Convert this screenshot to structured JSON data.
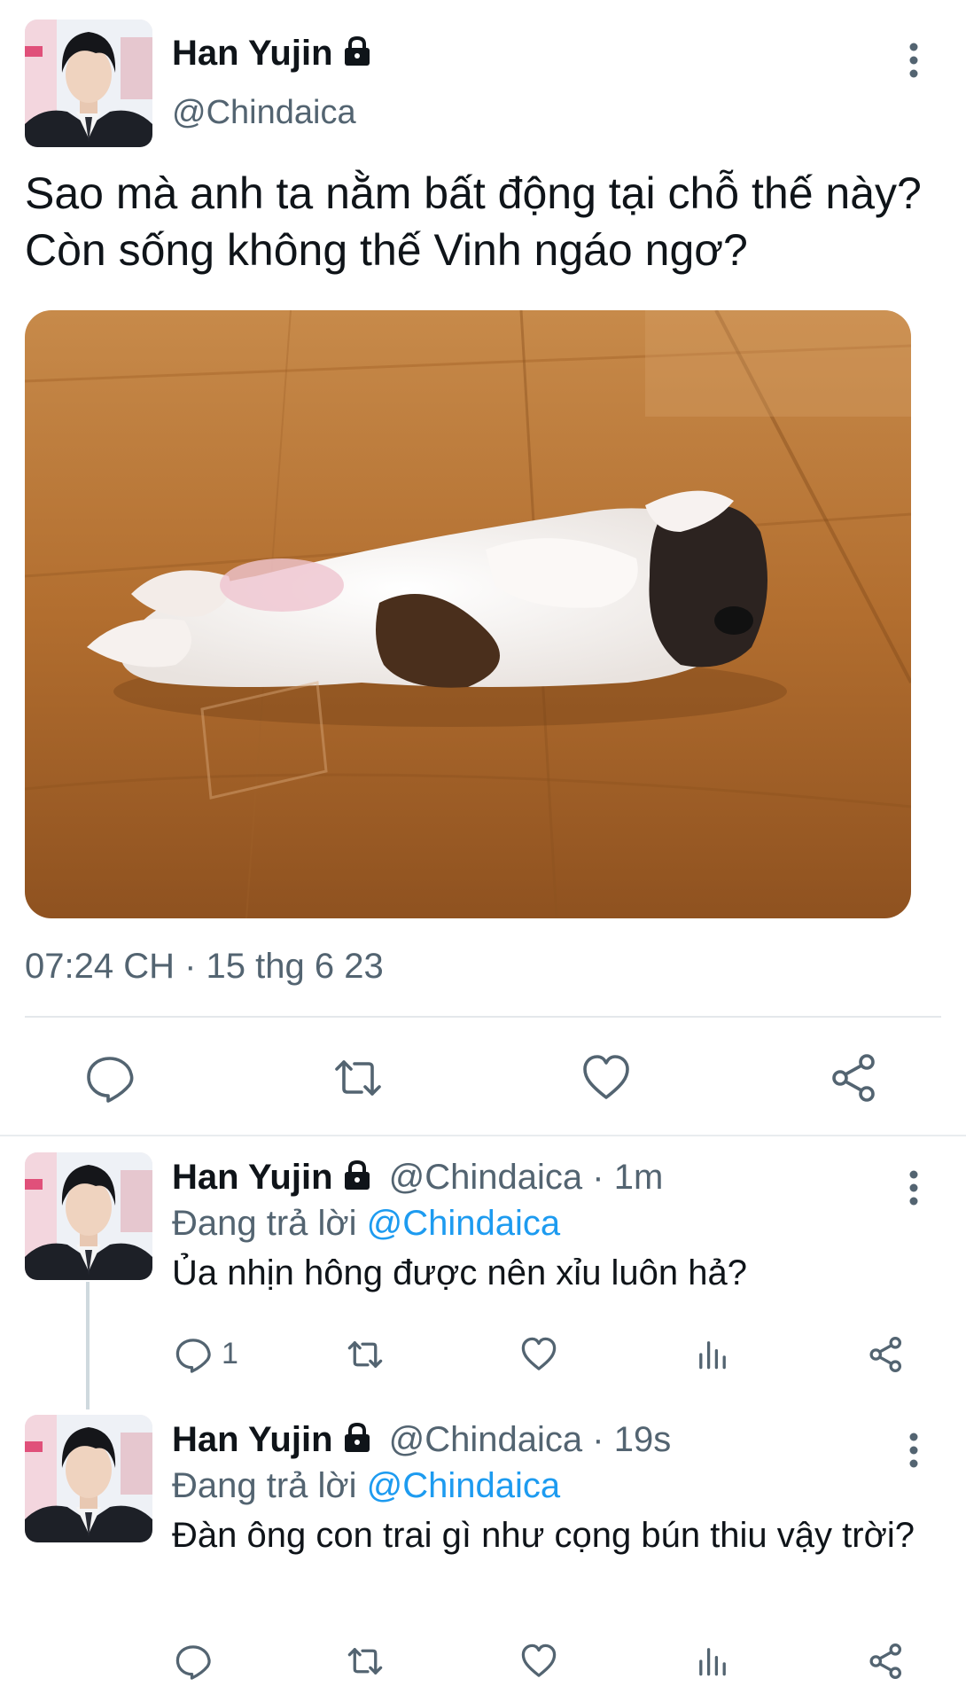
{
  "main_tweet": {
    "author": {
      "name": "Han Yujin",
      "handle": "@Chindaica",
      "avatar_icon": "profile-photo",
      "protected_icon": "lock-icon"
    },
    "text": "Sao mà anh ta nằm bất động tại chỗ thế này? Còn sống không thế Vinh ngáo ngơ?",
    "media": {
      "description_icon": "puppy-photo"
    },
    "timestamp": "07:24 CH · 15 thg 6 23",
    "actions": [
      {
        "name": "reply-icon"
      },
      {
        "name": "retweet-icon"
      },
      {
        "name": "like-icon"
      },
      {
        "name": "share-icon"
      }
    ]
  },
  "replies": [
    {
      "name": "Han Yujin",
      "handle": "@Chindaica",
      "separator": "·",
      "time": "1m",
      "replying_prefix": "Đang trả lời",
      "replying_to": "@Chindaica",
      "text": "Ủa nhịn hông được nên xỉu luôn hả?",
      "reply_count": "1"
    },
    {
      "name": "Han Yujin",
      "handle": "@Chindaica",
      "separator": "·",
      "time": "19s",
      "replying_prefix": "Đang trả lời",
      "replying_to": "@Chindaica",
      "text": "Đàn ông con trai gì như cọng bún thiu vậy trời?",
      "reply_count": ""
    }
  ],
  "colors": {
    "text": "#0f1419",
    "secondary": "#536471",
    "link": "#1d9bf0",
    "divider": "#e4e8eb"
  }
}
